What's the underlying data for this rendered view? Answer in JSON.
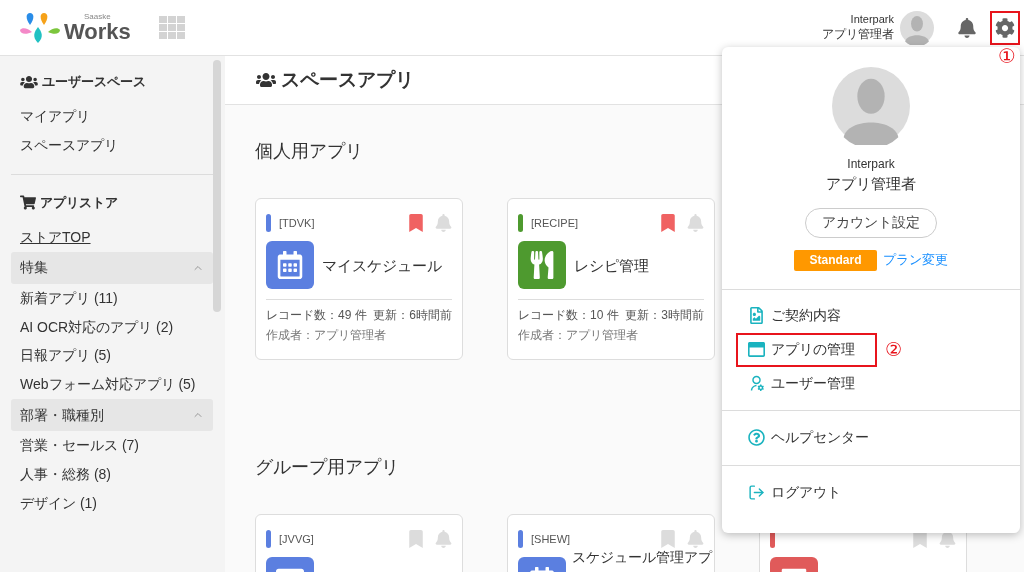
{
  "header": {
    "logo_small": "Saaske",
    "logo": "Works",
    "user_org": "Interpark",
    "user_role": "アプリ管理者",
    "settings_highlighted": true,
    "settings_annotation": "①"
  },
  "sidebar": {
    "sections": [
      {
        "title": "ユーザースペース",
        "items": [
          {
            "kind": "item",
            "label": "マイアプリ"
          },
          {
            "kind": "item",
            "label": "スペースアプリ"
          }
        ]
      },
      {
        "title": "アプリストア",
        "items": [
          {
            "kind": "link",
            "label": "ストアTOP"
          },
          {
            "kind": "group",
            "label": "特集",
            "expanded": true
          },
          {
            "kind": "item",
            "label": "新着アプリ (11)"
          },
          {
            "kind": "item",
            "label": "AI OCR対応のアプリ (2)"
          },
          {
            "kind": "item",
            "label": "日報アプリ (5)"
          },
          {
            "kind": "item",
            "label": "Webフォーム対応アプリ (5)"
          },
          {
            "kind": "group",
            "label": "部署・職種別",
            "expanded": true
          },
          {
            "kind": "item",
            "label": "営業・セールス (7)"
          },
          {
            "kind": "item",
            "label": "人事・総務 (8)"
          },
          {
            "kind": "item",
            "label": "デザイン (1)"
          }
        ]
      }
    ]
  },
  "page_title": "スペースアプリ",
  "sections": [
    {
      "title": "個人用アプリ",
      "cards": [
        {
          "code": "[TDVK]",
          "color": "#5b7fe0",
          "kind": "calendar",
          "name": "マイスケジュール",
          "bookmarked": true,
          "stats": "レコード数：49 件  更新：6時間前",
          "author": "作成者：アプリ管理者"
        },
        {
          "code": "[RECIPE]",
          "color": "#4e9a2f",
          "kind": "recipe",
          "name": "レシピ管理",
          "bookmarked": true,
          "stats": "レコード数：10 件  更新：3時間前",
          "author": "作成者：アプリ管理者"
        }
      ]
    },
    {
      "title": "グループ用アプリ",
      "cards": [
        {
          "code": "[JVVG]",
          "color": "#5b7fe0",
          "kind": "window",
          "bookmarked": false
        },
        {
          "code": "[SHEW]",
          "color": "#5b7fe0",
          "kind": "calendar",
          "name": "スケジュール管理アプ",
          "bookmarked": false
        },
        {
          "color": "#e05a5a",
          "kind": "note",
          "bookmarked": false
        }
      ]
    }
  ],
  "menu": {
    "org": "Interpark",
    "role": "アプリ管理者",
    "account_button": "アカウント設定",
    "plan": "Standard",
    "plan_link": "プラン変更",
    "groups": [
      [
        {
          "kind": "contract",
          "label": "ご契約内容",
          "highlighted": false
        },
        {
          "kind": "apps",
          "label": "アプリの管理",
          "highlighted": true,
          "annotation": "②"
        },
        {
          "kind": "users",
          "label": "ユーザー管理",
          "highlighted": false
        }
      ],
      [
        {
          "kind": "help",
          "label": "ヘルプセンター",
          "highlighted": false
        }
      ],
      [
        {
          "kind": "logout",
          "label": "ログアウト",
          "highlighted": false
        }
      ]
    ]
  }
}
